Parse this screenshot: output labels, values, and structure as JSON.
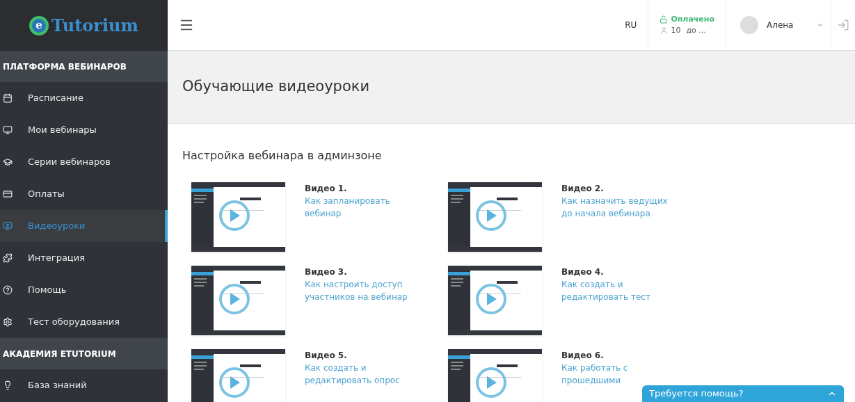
{
  "logo": {
    "text": "Tutorium",
    "mark": "e"
  },
  "sidebar": {
    "sections": [
      {
        "title": "ПЛАТФОРМА ВЕБИНАРОВ",
        "items": [
          {
            "label": "Расписание",
            "selected": false
          },
          {
            "label": "Мои вебинары",
            "selected": false
          },
          {
            "label": "Серии вебинаров",
            "selected": false
          },
          {
            "label": "Оплаты",
            "selected": false
          },
          {
            "label": "Видеоуроки",
            "selected": true
          },
          {
            "label": "Интеграция",
            "selected": false
          },
          {
            "label": "Помощь",
            "selected": false
          },
          {
            "label": "Тест оборудования",
            "selected": false
          }
        ]
      },
      {
        "title": "АКАДЕМИЯ ETUTORIUM",
        "items": [
          {
            "label": "База знаний",
            "selected": false
          }
        ]
      }
    ]
  },
  "topbar": {
    "language": "RU",
    "plan_status": "Оплачено",
    "participants": "10",
    "plan_until": "до ...",
    "user": "Алена"
  },
  "page_title": "Обучающие видеоуроки",
  "section_title": "Настройка вебинара в админзоне",
  "videos": [
    {
      "number": "Видео 1.",
      "title": "Как запланировать вебинар"
    },
    {
      "number": "Видео 2.",
      "title": "Как назначить ведущих до начала вебинара"
    },
    {
      "number": "Видео 3.",
      "title": "Как настроить доступ участников на вебинар"
    },
    {
      "number": "Видео 4.",
      "title": "Как создать и редактировать тест"
    },
    {
      "number": "Видео 5.",
      "title": "Как создать и редактировать опрос"
    },
    {
      "number": "Видео 6.",
      "title": "Как работать с прошедшими"
    }
  ],
  "help_widget": {
    "label": "Требуется помощь?",
    "expanded": false
  }
}
